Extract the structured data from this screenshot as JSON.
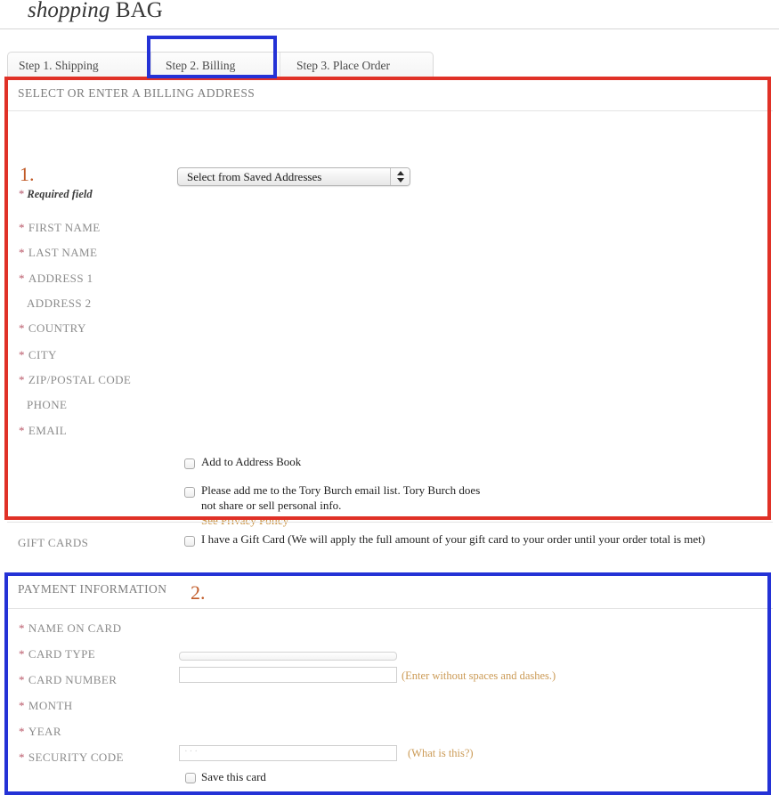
{
  "header": {
    "title_italic": "shopping",
    "title_rest": " BAG"
  },
  "tabs": [
    {
      "label": "Step 1. Shipping",
      "selected": false
    },
    {
      "label": "Step 2. Billing",
      "selected": true
    },
    {
      "label": "Step 3. Place Order",
      "selected": false
    }
  ],
  "billing": {
    "section_title": "SELECT OR ENTER A BILLING ADDRESS",
    "step_number": "1.",
    "saved_address_select": {
      "value": "Select from Saved Addresses",
      "options": [
        "Select from Saved Addresses"
      ]
    },
    "required_note_star": "*",
    "required_note": "Required field",
    "fields": [
      {
        "label": "FIRST NAME",
        "required": true
      },
      {
        "label": "LAST NAME",
        "required": true
      },
      {
        "label": "ADDRESS 1",
        "required": true
      },
      {
        "label": "ADDRESS 2",
        "required": false
      },
      {
        "label": "COUNTRY",
        "required": true
      },
      {
        "label": "CITY",
        "required": true
      },
      {
        "label": "ZIP/POSTAL CODE",
        "required": true
      },
      {
        "label": "PHONE",
        "required": false
      },
      {
        "label": "EMAIL",
        "required": true
      }
    ],
    "checkboxes": [
      {
        "label": "Add to Address Book",
        "checked": false
      },
      {
        "label": "Please add me to the Tory Burch email list. Tory Burch does not share or sell personal info.",
        "checked": false
      }
    ],
    "privacy_link": "See Privacy Policy"
  },
  "gift_cards": {
    "section_label": "GIFT CARDS",
    "checkbox_label": "I have a Gift Card (We will apply the full amount of your gift card to your order until your order total is met)",
    "checked": false
  },
  "payment": {
    "section_title": "PAYMENT INFORMATION",
    "step_number": "2.",
    "fields": [
      {
        "label": "NAME ON CARD",
        "required": true
      },
      {
        "label": "CARD TYPE",
        "required": true
      },
      {
        "label": "CARD NUMBER",
        "required": true
      },
      {
        "label": "MONTH",
        "required": true
      },
      {
        "label": "YEAR",
        "required": true
      },
      {
        "label": "SECURITY CODE",
        "required": true
      }
    ],
    "card_number_value": "",
    "card_number_hint": "(Enter without spaces and dashes.)",
    "security_code_value": "···",
    "security_code_hint": "(What is this?)",
    "save_card_label": "Save this card",
    "save_card_checked": false
  },
  "colors": {
    "annotation_red": "#e03127",
    "annotation_blue": "#2432d6",
    "step_number": "#c15a27",
    "required_star": "#bb5b6b",
    "link_amber": "#c9913f",
    "label_gray": "#8c8c8c"
  }
}
